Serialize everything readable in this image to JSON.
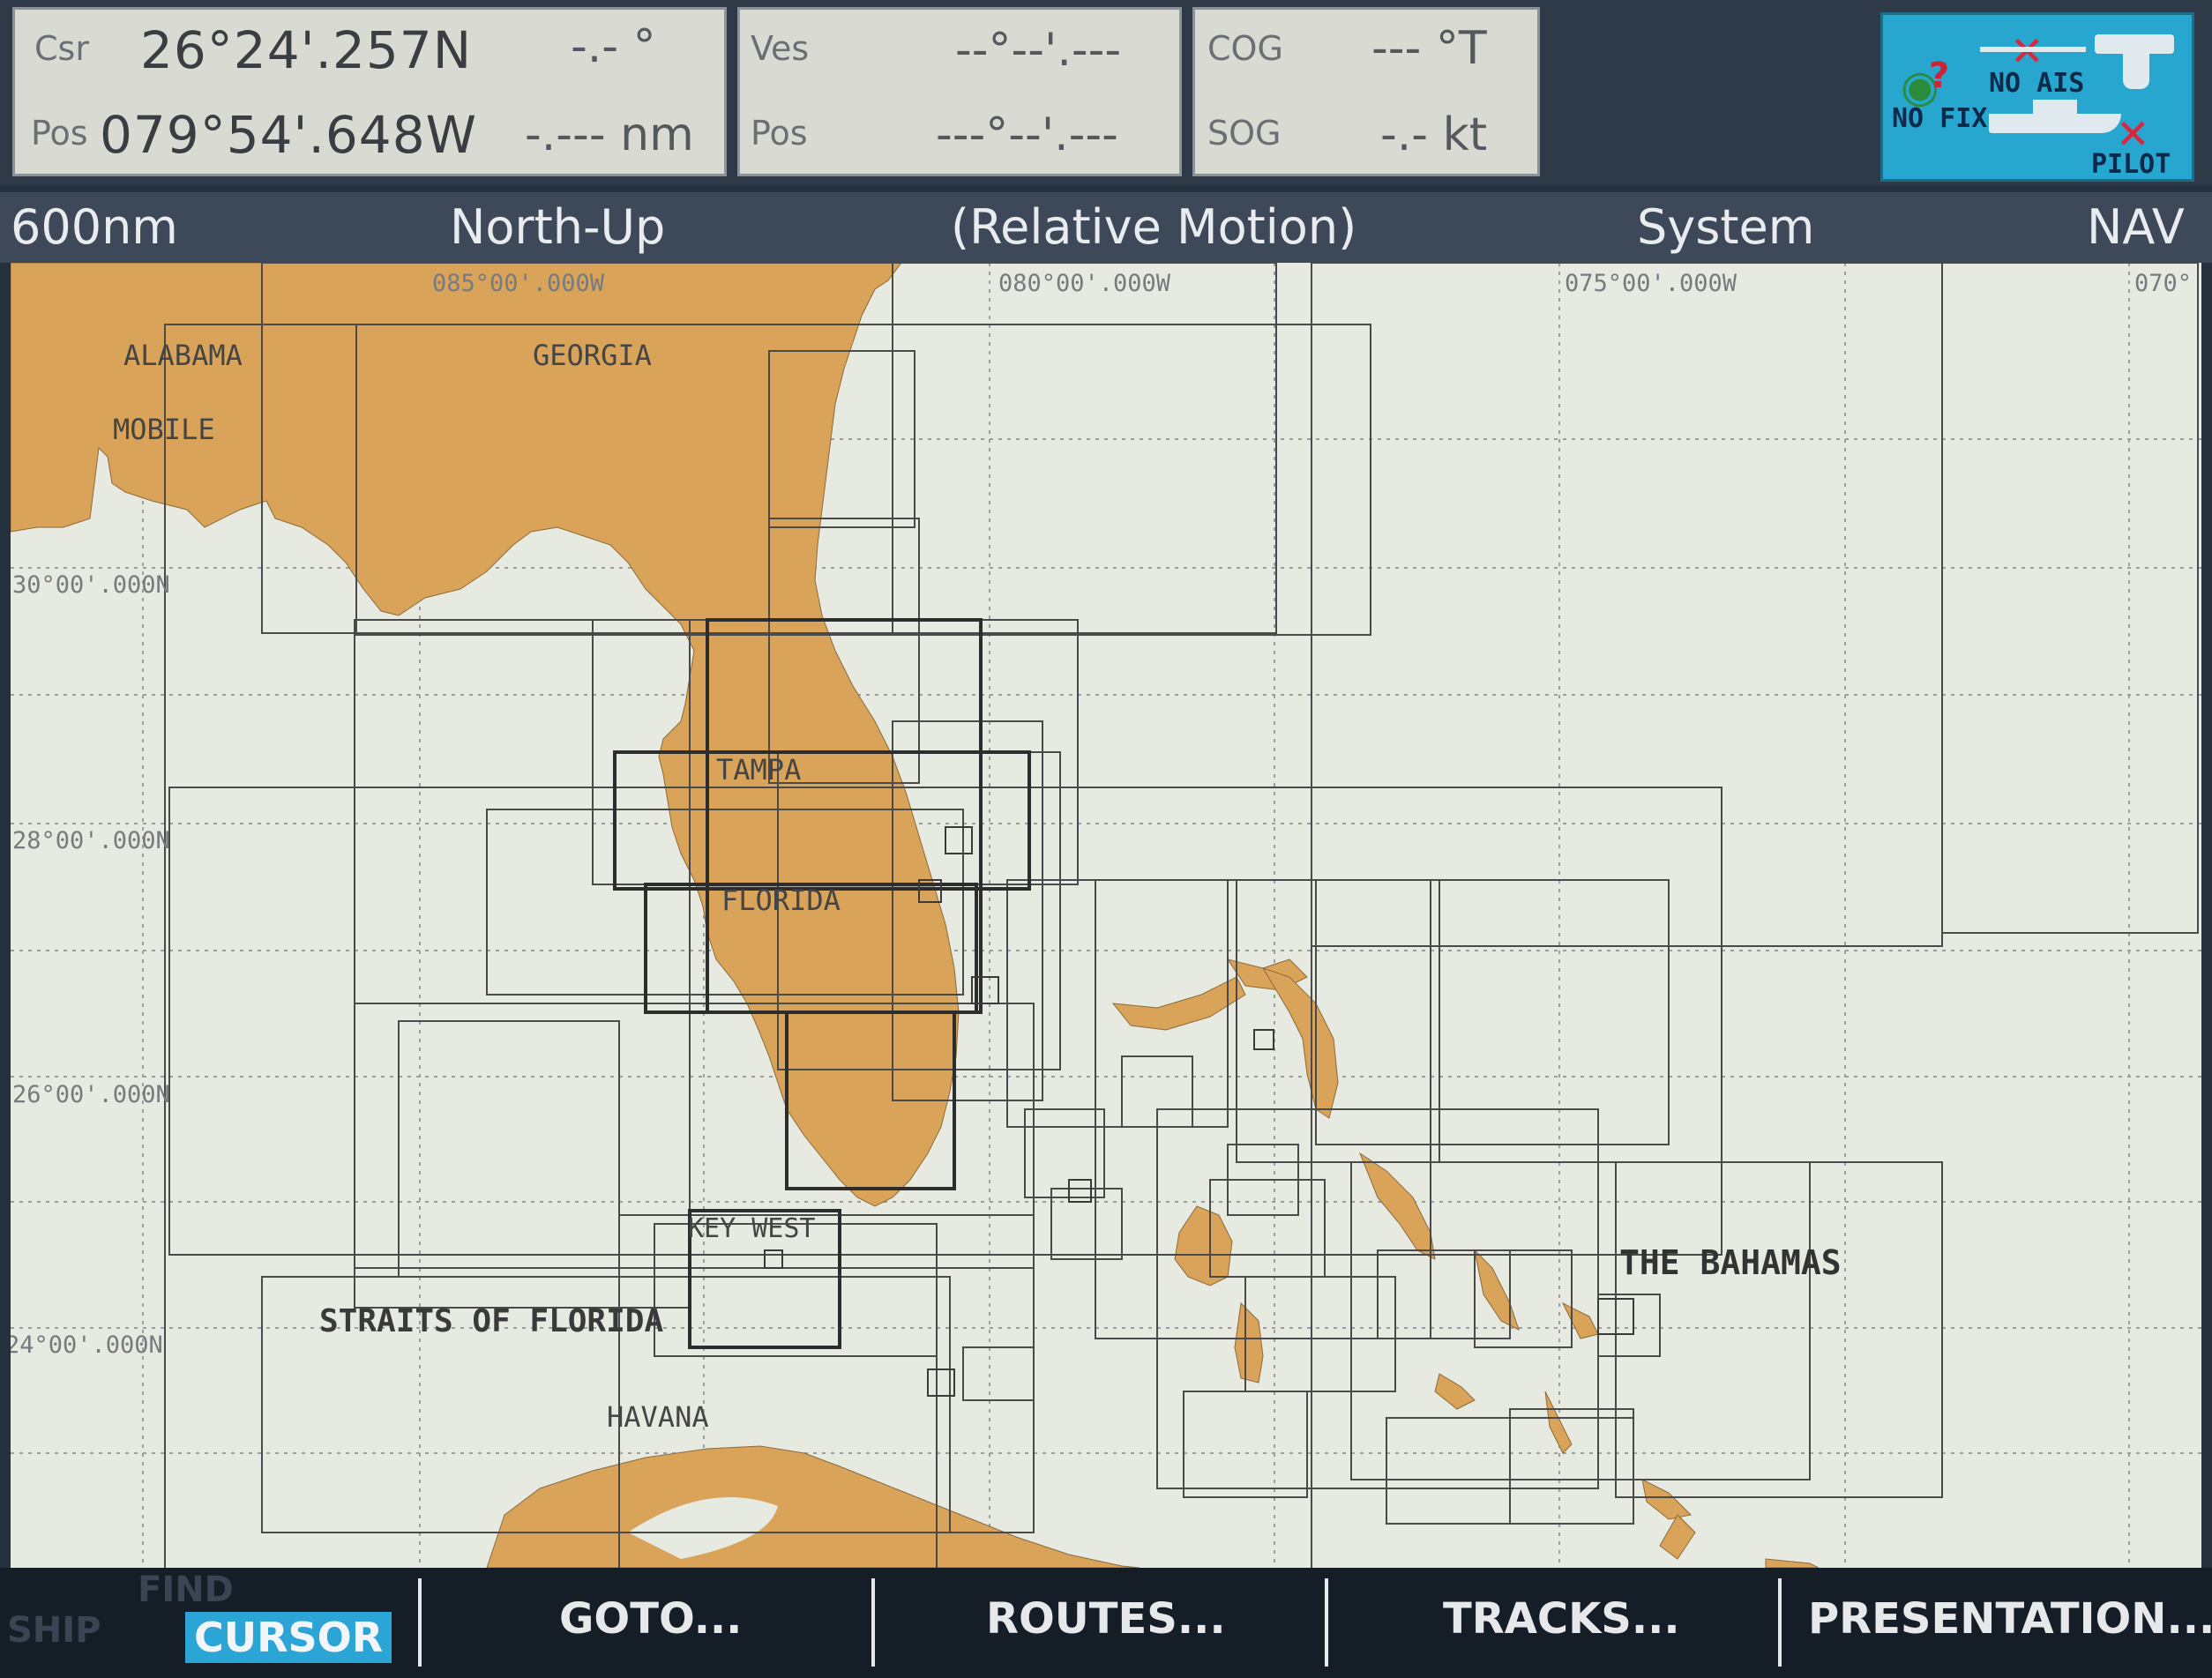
{
  "status": {
    "csr_label": "Csr",
    "csr_lat": "26°24'.257N",
    "csr_bearing": "-.- °",
    "pos_label": "Pos",
    "csr_lon": "079°54'.648W",
    "csr_range": "-.--- nm",
    "ves_label": "Ves",
    "ves_lat": "--°--'.---",
    "ves_pos_label": "Pos",
    "ves_lon": "---°--'.---",
    "cog_label": "COG",
    "cog_value": "--- °T",
    "sog_label": "SOG",
    "sog_value": "-.- kt",
    "no_fix": "NO FIX",
    "no_ais": "NO AIS",
    "pilot": "PILOT"
  },
  "chartbar": {
    "range": "600nm",
    "orientation": "North-Up",
    "motion": "(Relative Motion)",
    "mode": "System",
    "nav": "NAV"
  },
  "map": {
    "grid_labels": {
      "lon_85": "085°00'.000W",
      "lon_80": "080°00'.000W",
      "lon_75": "075°00'.000W",
      "lon_70": "070°",
      "lat_30": "30°00'.000N",
      "lat_28": "28°00'.000N",
      "lat_26": "26°00'.000N",
      "lat_24": "24°00'.000N"
    },
    "places": {
      "alabama": "ALABAMA",
      "mobile": "MOBILE",
      "georgia": "GEORGIA",
      "tampa": "TAMPA",
      "florida": "FLORIDA",
      "key_west": "KEY WEST",
      "straits": "STRAITS OF FLORIDA",
      "havana": "HAVANA",
      "bahamas": "THE BAHAMAS"
    },
    "colors": {
      "land": "#d9a35a",
      "sea": "#e7eae0",
      "chart_outline": "#4a4a4a"
    }
  },
  "softkeys": {
    "ship": "SHIP",
    "find": "FIND",
    "cursor": "CURSOR",
    "goto": "GOTO...",
    "routes": "ROUTES...",
    "tracks": "TRACKS...",
    "presentation": "PRESENTATION..."
  }
}
